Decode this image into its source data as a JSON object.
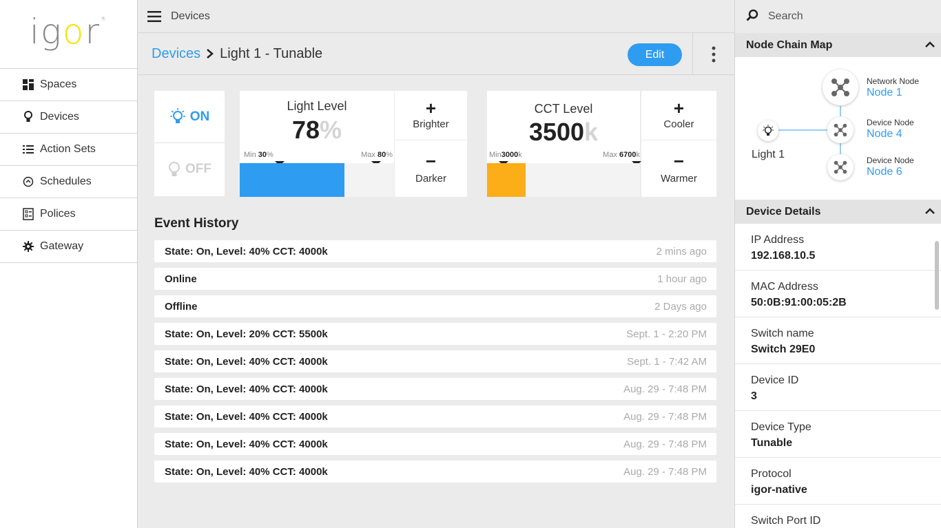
{
  "sidebar": {
    "logo_text": "igor",
    "logo_mark": "®",
    "items": [
      {
        "label": "Spaces",
        "icon": "grid-icon"
      },
      {
        "label": "Devices",
        "icon": "bulb-icon"
      },
      {
        "label": "Action Sets",
        "icon": "list-icon"
      },
      {
        "label": "Schedules",
        "icon": "clock-icon"
      },
      {
        "label": "Polices",
        "icon": "checklist-icon"
      },
      {
        "label": "Gateway",
        "icon": "gear-icon"
      }
    ]
  },
  "topbar": {
    "title": "Devices"
  },
  "search": {
    "placeholder": "Search"
  },
  "breadcrumb": {
    "parent": "Devices",
    "current": "Light 1 - Tunable"
  },
  "header": {
    "edit_label": "Edit"
  },
  "power": {
    "on_label": "ON",
    "off_label": "OFF",
    "state": "on"
  },
  "light_level": {
    "title": "Light Level",
    "value": "78",
    "unit": "%",
    "min_label": "Min",
    "min_value": "30",
    "min_unit": "%",
    "max_label": "Max",
    "max_value": "80",
    "max_unit": "%",
    "fill_fraction": 0.68,
    "fill_color": "#2e9cf0"
  },
  "cct_level": {
    "title": "CCT Level",
    "value": "3500",
    "unit": "k",
    "min_label": "Min",
    "min_value": "3000",
    "min_unit": "k",
    "max_label": "Max",
    "max_value": "6700",
    "max_unit": "k",
    "fill_fraction": 0.25,
    "fill_color": "#fbae17"
  },
  "controls": {
    "brighter": "Brighter",
    "darker": "Darker",
    "cooler": "Cooler",
    "warmer": "Warmer",
    "plus": "+",
    "minus": "−"
  },
  "events": {
    "title": "Event History",
    "rows": [
      {
        "text": "State: On, Level: 40% CCT: 4000k",
        "time": "2 mins ago"
      },
      {
        "text": "Online",
        "time": "1 hour ago"
      },
      {
        "text": "Offline",
        "time": "2 Days ago"
      },
      {
        "text": "State: On, Level: 20% CCT: 5500k",
        "time": "Sept. 1 - 2:20 PM"
      },
      {
        "text": "State: On, Level: 40% CCT: 4000k",
        "time": "Sept. 1 - 7:42 AM"
      },
      {
        "text": "State: On, Level: 40% CCT: 4000k",
        "time": "Aug. 29 - 7:48 PM"
      },
      {
        "text": "State: On, Level: 40% CCT: 4000k",
        "time": "Aug. 29 - 7:48 PM"
      },
      {
        "text": "State: On, Level: 40% CCT: 4000k",
        "time": "Aug. 29 - 7:48 PM"
      },
      {
        "text": "State: On, Level: 40% CCT: 4000k",
        "time": "Aug. 29 - 7:48 PM"
      }
    ]
  },
  "node_map": {
    "title": "Node Chain Map",
    "light_label": "Light 1",
    "nodes": [
      {
        "type": "Network Node",
        "name": "Node 1"
      },
      {
        "type": "Device Node",
        "name": "Node 4"
      },
      {
        "type": "Device Node",
        "name": "Node 6"
      }
    ]
  },
  "device_details": {
    "title": "Device Details",
    "fields": [
      {
        "label": "IP Address",
        "value": "192.168.10.5"
      },
      {
        "label": "MAC Address",
        "value": "50:0B:91:00:05:2B"
      },
      {
        "label": "Switch name",
        "value": "Switch 29E0"
      },
      {
        "label": "Device ID",
        "value": "3"
      },
      {
        "label": "Device Type",
        "value": "Tunable"
      },
      {
        "label": "Protocol",
        "value": "igor-native"
      },
      {
        "label": "Switch Port ID",
        "value": ""
      }
    ]
  },
  "colors": {
    "accent": "#2e9cf0",
    "warm": "#fbae17",
    "logo_o": "#f5e400"
  }
}
